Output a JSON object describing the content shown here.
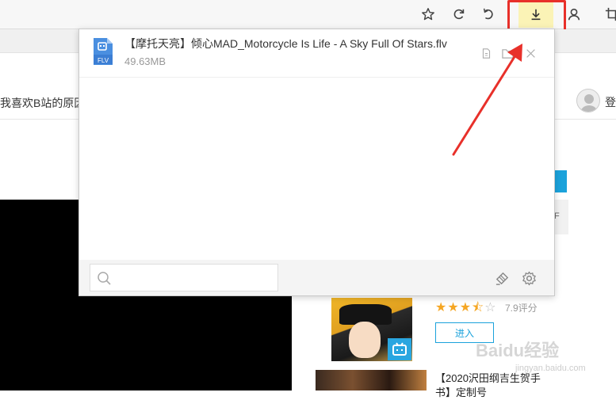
{
  "toolbar": {
    "buttons": [
      {
        "name": "star-icon",
        "label": "☆"
      },
      {
        "name": "refresh-icon"
      },
      {
        "name": "undo-icon"
      },
      {
        "name": "download-icon"
      },
      {
        "name": "user-icon"
      },
      {
        "name": "crop-icon"
      }
    ],
    "highlight_color": "#e8302a",
    "download_active_bg": "#fbf3b6"
  },
  "page": {
    "nav_text": "我喜欢B站的原因",
    "login_text": "登",
    "side_card_text": "F",
    "item1": {
      "stars_on": "★★★",
      "stars_half": "⯪",
      "stars_off": "☆",
      "rating": "7.9评分",
      "enter_label": "进入",
      "badge": "▣"
    },
    "item2": {
      "title": "【2020沢田纲吉生贺手书】定制号"
    },
    "watermark": "Baidu经验",
    "watermark_sub": "jingyan.baidu.com"
  },
  "downloads": {
    "items": [
      {
        "file_type": "FLV",
        "name": "【摩托天亮】倾心MAD_Motorcycle Is Life - A Sky Full Of Stars.flv",
        "size": "49.63MB"
      }
    ],
    "search": {
      "placeholder": "",
      "value": ""
    }
  }
}
